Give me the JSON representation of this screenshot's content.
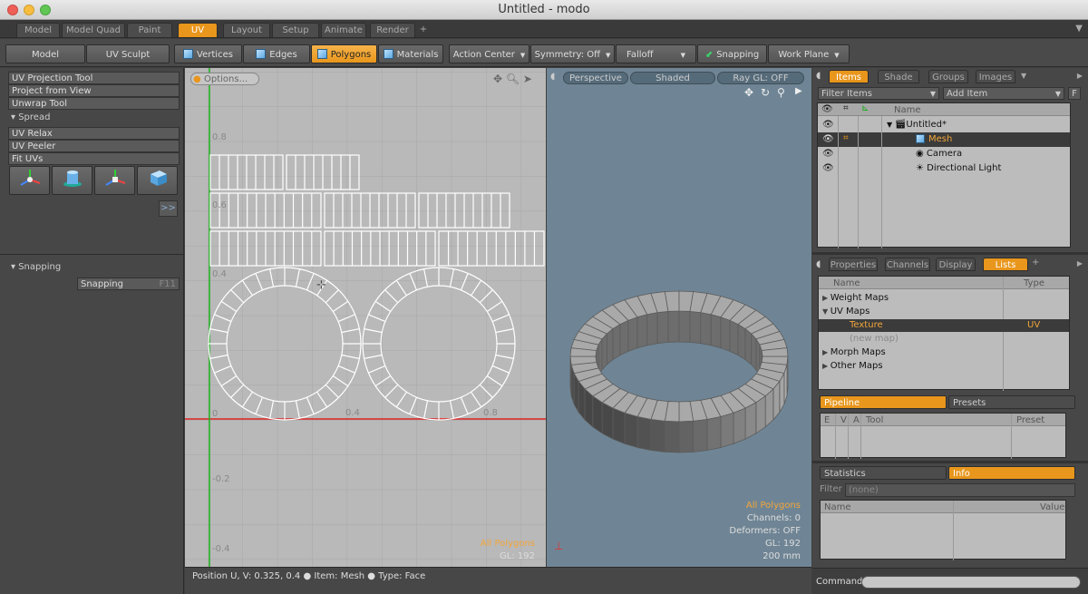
{
  "window": {
    "title": "Untitled - modo"
  },
  "layout_tabs": [
    "Model",
    "Model Quad",
    "Paint",
    "UV",
    "Layout",
    "Setup",
    "Animate",
    "Render",
    "+"
  ],
  "toolbar": {
    "model": "Model",
    "uv_sculpt": "UV Sculpt",
    "vertices": "Vertices",
    "edges": "Edges",
    "polygons": "Polygons",
    "materials": "Materials",
    "action_center": "Action Center",
    "symmetry": "Symmetry: Off",
    "falloff": "Falloff",
    "snapping": "Snapping",
    "work_plane": "Work Plane"
  },
  "left": {
    "tools": [
      "UV Projection Tool",
      "Project from View",
      "Unwrap Tool"
    ],
    "spread_header": "Spread",
    "tools2": [
      "UV Relax",
      "UV Peeler",
      "Fit UVs"
    ],
    "expand": ">>",
    "snapping_header": "Snapping",
    "snapping_label": "Snapping",
    "snapping_key": "F11"
  },
  "uv": {
    "options": "Options...",
    "labels": {
      "v08": "0.8",
      "v06": "0.6",
      "v04": "0.4",
      "zero": "0",
      "u04": "0.4",
      "u08": "0.8",
      "vm02": "-0.2",
      "vm04": "-0.4"
    },
    "all_polygons": "All Polygons",
    "gl": "GL: 192"
  },
  "persp": {
    "mode": "Perspective",
    "shading": "Shaded",
    "ray": "Ray GL: OFF",
    "all_polygons": "All Polygons",
    "channels": "Channels: 0",
    "deformers": "Deformers: OFF",
    "gl": "GL: 192",
    "size": "200 mm"
  },
  "status": {
    "position_label": "Position U, V:",
    "position_value": "0.325, 0.4",
    "item_label": "Item:",
    "item_value": "Mesh",
    "type_label": "Type:",
    "type_value": "Face"
  },
  "items": {
    "tabs": [
      "Items",
      "Shade ...",
      "Groups",
      "Images"
    ],
    "filter": "Filter Items",
    "add": "Add Item",
    "f": "F",
    "col_name": "Name",
    "tree": [
      {
        "label": "Untitled*"
      },
      {
        "label": "Mesh"
      },
      {
        "label": "Camera"
      },
      {
        "label": "Directional Light"
      }
    ]
  },
  "props": {
    "tabs": [
      "Properties",
      "Channels",
      "Display",
      "Lists",
      "+"
    ],
    "col_name": "Name",
    "col_type": "Type",
    "rows": [
      {
        "label": "Weight Maps",
        "type": ""
      },
      {
        "label": "UV Maps",
        "type": ""
      },
      {
        "label": "Texture",
        "type": "UV"
      },
      {
        "label": "(new map)",
        "type": ""
      },
      {
        "label": "Morph Maps",
        "type": ""
      },
      {
        "label": "Other Maps",
        "type": ""
      }
    ]
  },
  "pipeline": {
    "tab1": "Pipeline",
    "tab2": "Presets",
    "cols": [
      "E",
      "V",
      "A",
      "Tool"
    ],
    "preset": "Preset"
  },
  "stats": {
    "tab1": "Statistics",
    "tab2": "Info",
    "filter_label": "Filter",
    "filter_value": "(none)",
    "col_name": "Name",
    "col_value": "Value"
  },
  "command": {
    "label": "Command"
  }
}
